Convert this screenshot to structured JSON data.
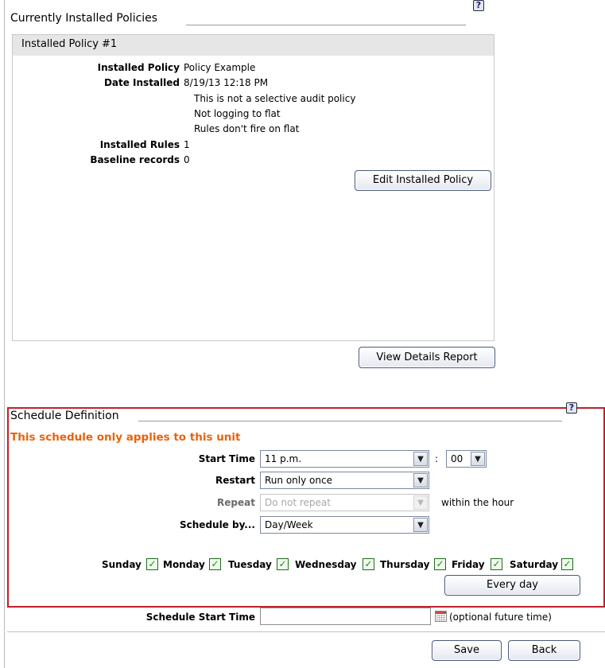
{
  "installed": {
    "section_title": "Currently Installed Policies",
    "help_icon": "?",
    "policy_header": "Installed Policy #1",
    "fields": {
      "installed_policy_label": "Installed Policy",
      "installed_policy_value": "Policy Example",
      "date_installed_label": "Date Installed",
      "date_installed_value": "8/19/13 12:18 PM",
      "note_1": "This is not a selective audit policy",
      "note_2": "Not logging to flat",
      "note_3": "Rules don't fire on flat",
      "installed_rules_label": "Installed Rules",
      "installed_rules_value": "1",
      "baseline_label": "Baseline records",
      "baseline_value": "0"
    },
    "edit_button": "Edit Installed Policy",
    "view_details_button": "View Details Report"
  },
  "schedule": {
    "section_title": "Schedule Definition",
    "help_icon": "?",
    "warning": "This schedule only applies to this unit",
    "start_time_label": "Start Time",
    "start_time_hour": "11 p.m.",
    "time_separator": ":",
    "start_time_minute": "00",
    "restart_label": "Restart",
    "restart_value": "Run only once",
    "repeat_label": "Repeat",
    "repeat_value": "Do not repeat",
    "repeat_suffix": "within the hour",
    "schedule_by_label": "Schedule by...",
    "schedule_by_value": "Day/Week",
    "days": {
      "sunday": "Sunday",
      "monday": "Monday",
      "tuesday": "Tuesday",
      "wednesday": "Wednesday",
      "thursday": "Thursday",
      "friday": "Friday",
      "saturday": "Saturday"
    },
    "checkmark": "✓",
    "every_day_button": "Every day"
  },
  "footer": {
    "schedule_start_label": "Schedule Start Time",
    "schedule_start_value": "",
    "optional_hint": "(optional future time)",
    "save_button": "Save",
    "back_button": "Back"
  },
  "colors": {
    "warning_text": "#e8630a",
    "schedule_border": "#c0202a",
    "checkbox_check": "#1b8f1b"
  },
  "icons": {
    "help": "help-icon",
    "dropdown": "chevron-down-icon",
    "calendar": "calendar-icon",
    "checkbox": "checkbox-checked-icon"
  }
}
